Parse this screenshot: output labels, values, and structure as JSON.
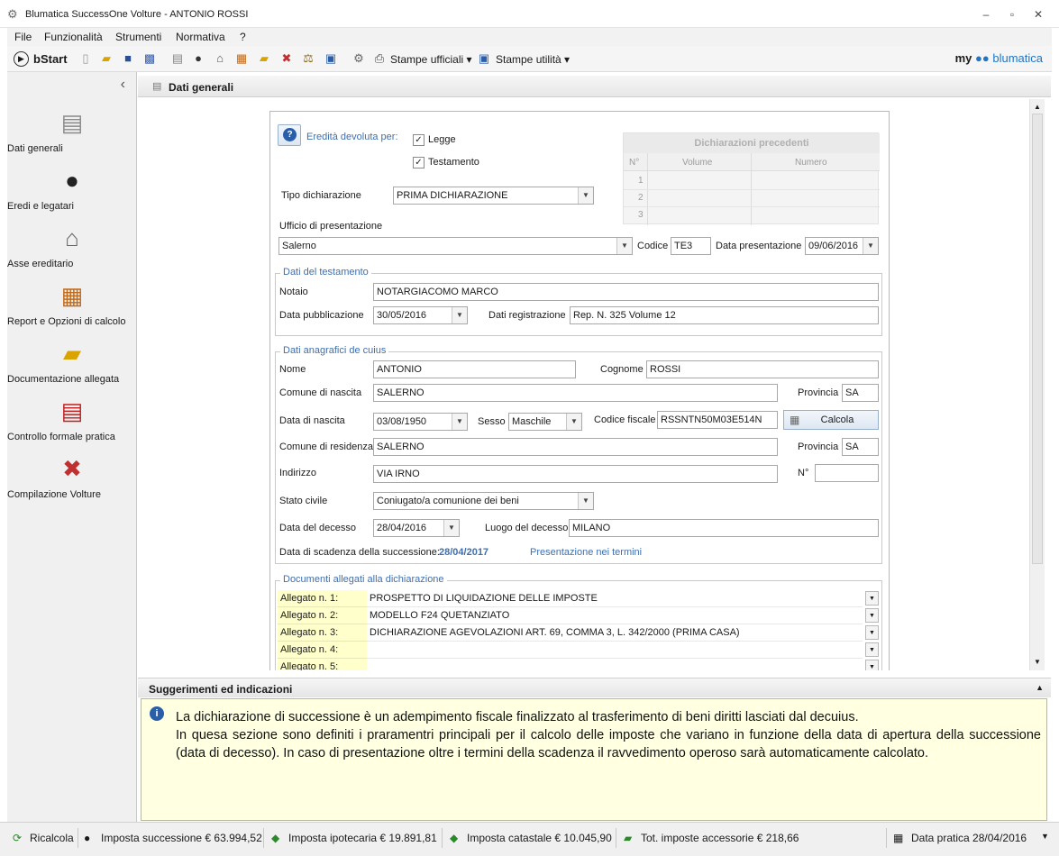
{
  "window": {
    "title": "Blumatica SuccessOne Volture - ANTONIO ROSSI"
  },
  "menu": [
    "File",
    "Funzionalità",
    "Strumenti",
    "Normativa",
    "?"
  ],
  "toolbar": {
    "bstart_label": "bStart",
    "stampe_ufficiali_label": "Stampe ufficiali",
    "stampe_utilita_label": "Stampe utilità",
    "brand_my": "my",
    "brand_name": "blumatica"
  },
  "sidebar": {
    "collapse_glyph": "‹",
    "items": [
      {
        "label": "Dati generali",
        "icon": "document-icon"
      },
      {
        "label": "Eredi e legatari",
        "icon": "person-icon"
      },
      {
        "label": "Asse ereditario",
        "icon": "house-icon"
      },
      {
        "label": "Report e Opzioni di calcolo",
        "icon": "calculator-icon"
      },
      {
        "label": "Documentazione allegata",
        "icon": "folder-icon"
      },
      {
        "label": "Controllo formale pratica",
        "icon": "check-document-icon"
      },
      {
        "label": "Compilazione Volture",
        "icon": "volture-icon"
      }
    ]
  },
  "main": {
    "header_title": "Dati generali",
    "help_icon": "?",
    "eredita_label": "Eredità devoluta per:",
    "legge_label": "Legge",
    "testamento_label": "Testamento",
    "legge_checked": true,
    "testamento_checked": true,
    "tipo_dichiarazione_label": "Tipo dichiarazione",
    "tipo_dichiarazione_value": "PRIMA DICHIARAZIONE",
    "ufficio_label": "Ufficio di presentazione",
    "ufficio_value": "Salerno",
    "codice_label": "Codice",
    "codice_value": "TE3",
    "data_presentazione_label": "Data presentazione",
    "data_presentazione_value": "09/06/2016",
    "dich_precedenti": {
      "title": "Dichiarazioni precedenti",
      "columns": [
        "N°",
        "Volume",
        "Numero"
      ],
      "rows": [
        "1",
        "2",
        "3"
      ]
    },
    "testamento": {
      "group_title": "Dati del testamento",
      "notaio_label": "Notaio",
      "notaio_value": "NOTARGIACOMO MARCO",
      "data_pub_label": "Data pubblicazione",
      "data_pub_value": "30/05/2016",
      "data_reg_label": "Dati registrazione",
      "data_reg_value": "Rep. N. 325 Volume 12"
    },
    "cuius": {
      "group_title": "Dati anagrafici de cuius",
      "nome_label": "Nome",
      "nome_value": "ANTONIO",
      "cognome_label": "Cognome",
      "cognome_value": "ROSSI",
      "comune_nascita_label": "Comune di nascita",
      "comune_nascita_value": "SALERNO",
      "provincia_label": "Provincia",
      "provincia_nascita_value": "SA",
      "data_nascita_label": "Data di nascita",
      "data_nascita_value": "03/08/1950",
      "sesso_label": "Sesso",
      "sesso_value": "Maschile",
      "cf_label": "Codice fiscale",
      "cf_value": "RSSNTN50M03E514N",
      "calcola_label": "Calcola",
      "comune_res_label": "Comune di residenza",
      "comune_res_value": "SALERNO",
      "provincia_res_value": "SA",
      "indirizzo_label": "Indirizzo",
      "indirizzo_value": "VIA IRNO",
      "numero_label": "N°",
      "numero_value": "",
      "stato_civile_label": "Stato civile",
      "stato_civile_value": "Coniugato/a comunione dei beni",
      "data_decesso_label": "Data del decesso",
      "data_decesso_value": "28/04/2016",
      "luogo_decesso_label": "Luogo del decesso",
      "luogo_decesso_value": "MILANO",
      "scadenza_label": "Data di scadenza della successione:",
      "scadenza_value": "28/04/2017",
      "presentazione_note": "Presentazione nei termini"
    },
    "allegati": {
      "group_title": "Documenti allegati alla dichiarazione",
      "rows": [
        {
          "label": "Allegato n. 1:",
          "value": "PROSPETTO DI LIQUIDAZIONE DELLE IMPOSTE"
        },
        {
          "label": "Allegato n. 2:",
          "value": "MODELLO F24 QUETANZIATO"
        },
        {
          "label": "Allegato n. 3:",
          "value": "DICHIARAZIONE AGEVOLAZIONI ART. 69, COMMA 3, L. 342/2000 (PRIMA CASA)"
        },
        {
          "label": "Allegato n. 4:",
          "value": ""
        },
        {
          "label": "Allegato n. 5:",
          "value": ""
        }
      ]
    }
  },
  "suggestions": {
    "title": "Suggerimenti ed indicazioni",
    "text1": "La dichiarazione di successione è un adempimento fiscale finalizzato al trasferimento di beni diritti lasciati dal decuius.",
    "text2": "In quesa sezione sono definiti i praramentri principali per il calcolo delle imposte che variano in funzione della data di apertura della successione (data di decesso). In caso di presentazione oltre i termini della scadenza il ravvedimento operoso sarà automaticamente calcolato."
  },
  "status": {
    "ricalcola": "Ricalcola",
    "imposta_successione": "Imposta successione € 63.994,52",
    "imposta_ipotecaria": "Imposta ipotecaria € 19.891,81",
    "imposta_catastale": "Imposta catastale € 10.045,90",
    "tot_accessorie": "Tot. imposte accessorie € 218,66",
    "data_pratica": "Data pratica 28/04/2016"
  },
  "colors": {
    "accent_blue": "#3f6fae",
    "allegato_label_bg": "#ffffcc",
    "suggestion_bg": "#ffffe1"
  }
}
